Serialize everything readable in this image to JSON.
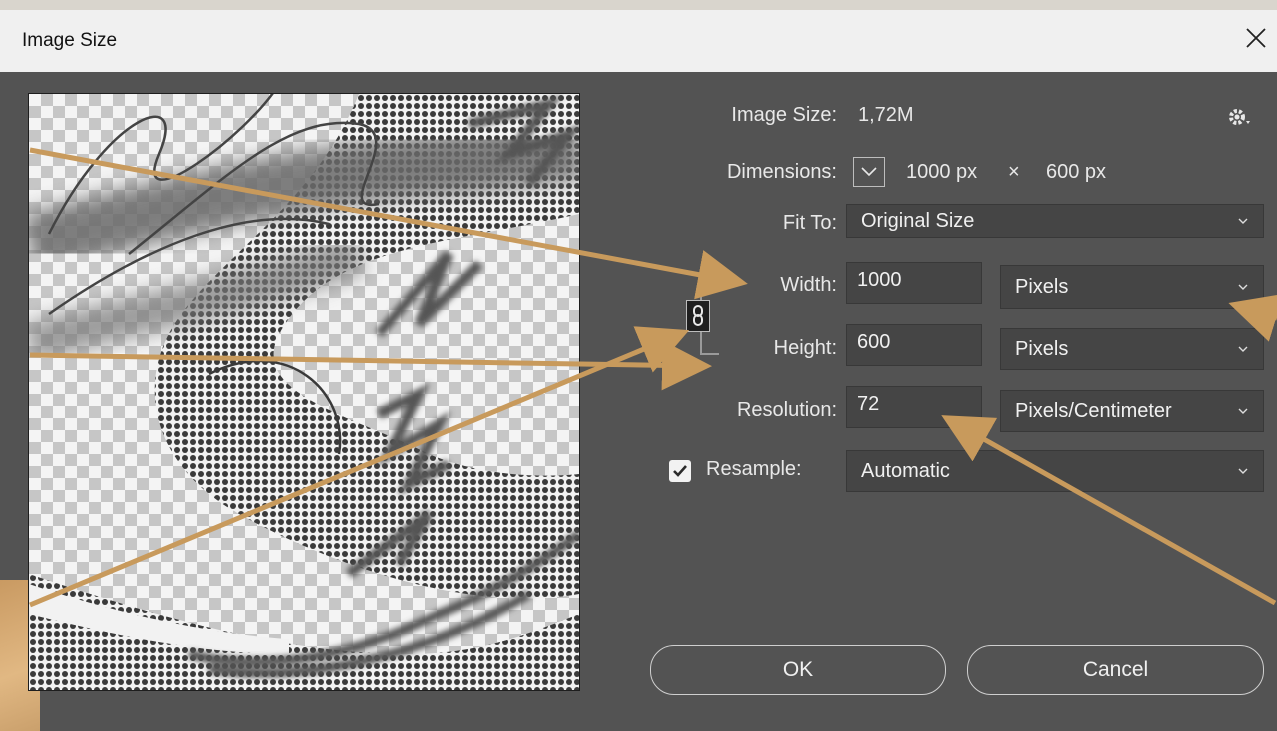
{
  "window": {
    "title": "Image Size"
  },
  "info": {
    "image_size_label": "Image Size:",
    "image_size_value": "1,72M",
    "dimensions_label": "Dimensions:",
    "dimensions_width": "1000 px",
    "dimensions_sep": "×",
    "dimensions_height": "600 px"
  },
  "fit_to": {
    "label": "Fit To:",
    "value": "Original Size"
  },
  "width": {
    "label": "Width:",
    "value": "1000",
    "unit": "Pixels"
  },
  "height": {
    "label": "Height:",
    "value": "600",
    "unit": "Pixels"
  },
  "resolution": {
    "label": "Resolution:",
    "value": "72",
    "unit": "Pixels/Centimeter"
  },
  "resample": {
    "label": "Resample:",
    "checked": true,
    "value": "Automatic"
  },
  "buttons": {
    "ok": "OK",
    "cancel": "Cancel"
  },
  "colors": {
    "dialog_bg": "#535353",
    "annotation_arrow": "#c89a5c"
  },
  "icons": [
    "close-icon",
    "gear-icon",
    "chevron-down-icon",
    "link-icon",
    "checkmark-icon"
  ]
}
